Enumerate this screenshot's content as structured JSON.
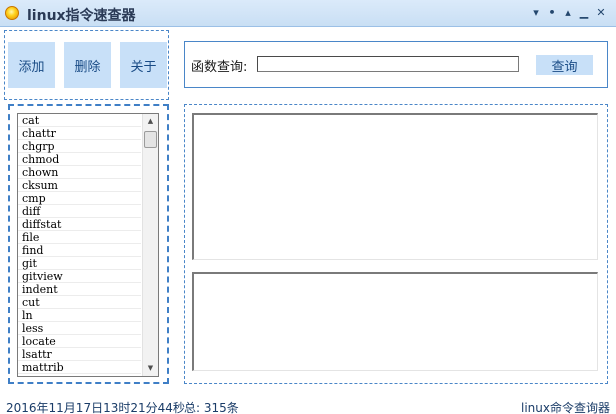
{
  "window": {
    "title": "linux指令速查器",
    "controls": [
      "▾",
      "•",
      "▴",
      "▁",
      "✕"
    ]
  },
  "toolbar": {
    "add_label": "添加",
    "delete_label": "删除",
    "about_label": "关于"
  },
  "search": {
    "label": "函数查询:",
    "value": "",
    "placeholder": "",
    "button_label": "查询"
  },
  "command_list": {
    "items": [
      "cat",
      "chattr",
      "chgrp",
      "chmod",
      "chown",
      "cksum",
      "cmp",
      "diff",
      "diffstat",
      "file",
      "find",
      "git",
      "gitview",
      "indent",
      "cut",
      "ln",
      "less",
      "locate",
      "lsattr",
      "mattrib"
    ]
  },
  "detail": {
    "upper_text": "",
    "lower_text": ""
  },
  "status": {
    "datetime": "2016年11月17日13时21分44秒",
    "total": "总: 315条",
    "app_name": "linux命令查询器"
  },
  "icons": {
    "app": "app-sun-icon",
    "scroll_up": "scroll-up-arrow-icon",
    "scroll_down": "scroll-down-arrow-icon"
  },
  "colors": {
    "accent": "#4a86c8",
    "button_bg": "#c8e0f8",
    "titlebar_bg": "#d1e4f6",
    "text": "#1a3c68"
  }
}
